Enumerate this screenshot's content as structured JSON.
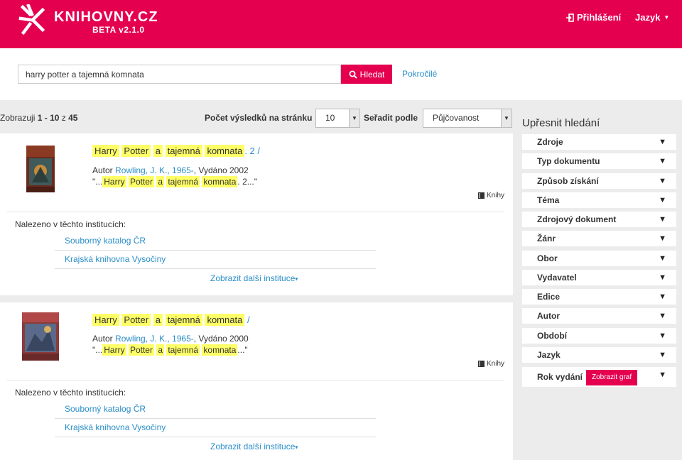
{
  "header": {
    "logo_name": "KNIHOVNY.CZ",
    "logo_version": "BETA v2.1.0",
    "login_label": "Přihlášení",
    "language_label": "Jazyk",
    "brand_color": "#e4004f"
  },
  "search": {
    "query": "harry potter a tajemná komnata",
    "button_label": "Hledat",
    "advanced_label": "Pokročilé"
  },
  "results_bar": {
    "showing_prefix": "Zobrazuji",
    "range_start": "1",
    "range_dash": "-",
    "range_end": "10",
    "of_word": "z",
    "total": "45",
    "per_page_label": "Počet výsledků na stránku",
    "per_page_value": "10",
    "sort_label": "Seřadit podle",
    "sort_value": "Půjčovanost"
  },
  "results": [
    {
      "title_words": [
        "Harry",
        "Potter",
        "a",
        "tajemná",
        "komnata"
      ],
      "title_tail": ". 2 /",
      "author_prefix": "Autor",
      "author": "Rowling, J. K., 1965-",
      "published": ", Vydáno 2002",
      "snippet_open": "\"...",
      "snippet_tail": ". 2...\"",
      "doctype": "Knihy",
      "found_label": "Nalezeno v těchto institucích:",
      "institutions": [
        "Souborný katalog ČR",
        "Krajská knihovna Vysočiny"
      ],
      "more_label": "Zobrazit další instituce"
    },
    {
      "title_words": [
        "Harry",
        "Potter",
        "a",
        "tajemná",
        "komnata"
      ],
      "title_tail": " /",
      "author_prefix": "Autor",
      "author": "Rowling, J. K., 1965-",
      "published": ", Vydáno 2000",
      "snippet_open": "\"...",
      "snippet_tail": "...\"",
      "doctype": "Knihy",
      "found_label": "Nalezeno v těchto institucích:",
      "institutions": [
        "Souborný katalog ČR",
        "Krajská knihovna Vysočiny"
      ],
      "more_label": "Zobrazit další instituce"
    }
  ],
  "facets": {
    "title": "Upřesnit hledání",
    "items": [
      "Zdroje",
      "Typ dokumentu",
      "Způsob získání",
      "Téma",
      "Zdrojový dokument",
      "Žánr",
      "Obor",
      "Vydavatel",
      "Edice",
      "Autor",
      "Období",
      "Jazyk"
    ],
    "rok_label": "Rok vydání",
    "graf_button": "Zobrazit graf"
  }
}
